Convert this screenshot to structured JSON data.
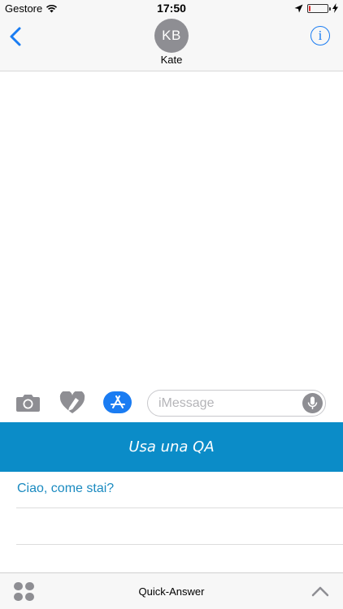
{
  "status_bar": {
    "carrier": "Gestore",
    "time": "17:50",
    "battery_level": 0.1
  },
  "header": {
    "avatar_initials": "KB",
    "contact_name": "Kate",
    "info_symbol": "i"
  },
  "compose": {
    "placeholder": "iMessage"
  },
  "extension": {
    "banner_label": "Usa una QA",
    "answers": [
      "Ciao, come stai?",
      ""
    ]
  },
  "drawer": {
    "title": "Quick-Answer"
  },
  "colors": {
    "accent": "#1a7cf2",
    "banner": "#0b8cc8",
    "answer_text": "#1a8ac0",
    "battery_low": "#e03030"
  },
  "icons": [
    "wifi-icon",
    "location-arrow-icon",
    "battery-icon",
    "charging-bolt-icon",
    "back-chevron-icon",
    "info-icon",
    "camera-icon",
    "digital-touch-heart-icon",
    "app-store-icon",
    "microphone-icon",
    "app-drawer-grid-icon",
    "chevron-up-icon"
  ]
}
